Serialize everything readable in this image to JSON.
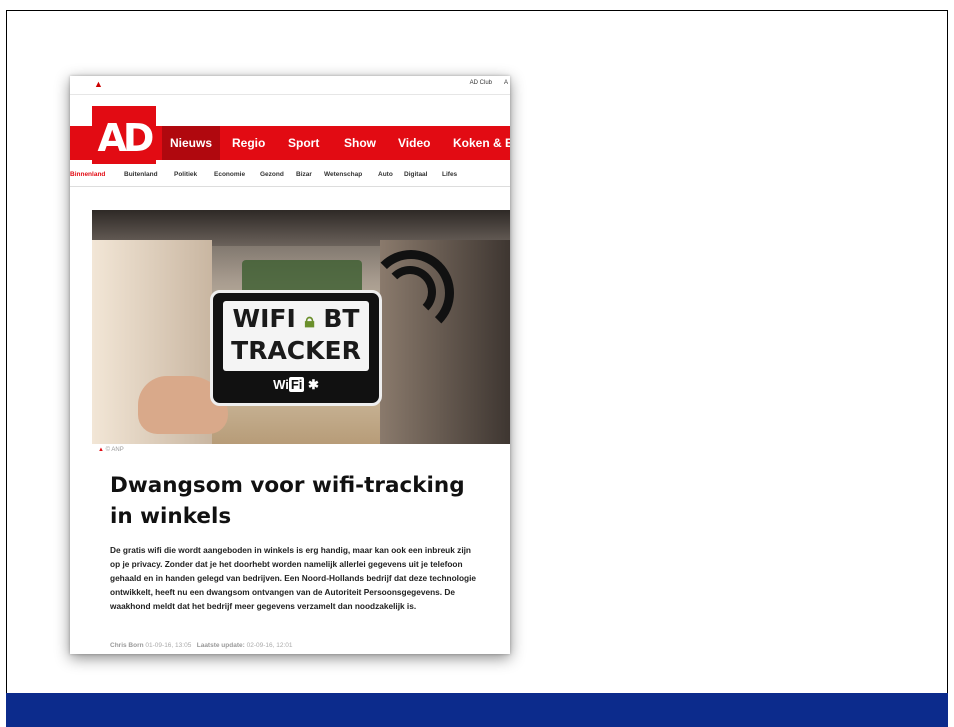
{
  "card": {
    "topbar": {
      "left_icon": "red-bird-icon",
      "links": [
        "AD Club",
        "A"
      ]
    },
    "logo_text": "AD",
    "main_nav": [
      "Nieuws",
      "Regio",
      "Sport",
      "Show",
      "Video",
      "Koken & Et"
    ],
    "active_nav": "Nieuws",
    "sub_nav": [
      "Binnenland",
      "Buitenland",
      "Politiek",
      "Economie",
      "Gezond",
      "Bizar",
      "Wetenschap",
      "Auto",
      "Digitaal",
      "Lifes"
    ],
    "photo": {
      "sign_line1_a": "WIFI",
      "sign_line1_b": "BT",
      "sign_line2": "TRACKER",
      "sign_foot_a": "Wi",
      "sign_foot_b": "Fi",
      "sign_foot_c": "✱"
    },
    "photo_credit": "© ANP",
    "headline": "Dwangsom voor wifi-tracking in winkels",
    "lead": "De gratis wifi die wordt aangeboden in winkels is erg handig, maar kan ook een inbreuk zijn op je privacy. Zonder dat je het doorhebt worden namelijk allerlei gegevens uit je telefoon gehaald en in handen gelegd van bedrijven. Een Noord-Hollands bedrijf dat deze technologie ontwikkelt, heeft nu een dwangsom ontvangen van de Autoriteit Persoonsgegevens. De waakhond meldt dat het bedrijf meer gegevens verzamelt dan noodzakelijk is.",
    "meta": {
      "author": "Chris Born",
      "published": "01-09-16, 13:05",
      "update_label": "Laatste update:",
      "updated": "02-09-16, 12:01"
    }
  },
  "colors": {
    "brand_red": "#e20b13",
    "footer_blue": "#0c2b8c"
  }
}
